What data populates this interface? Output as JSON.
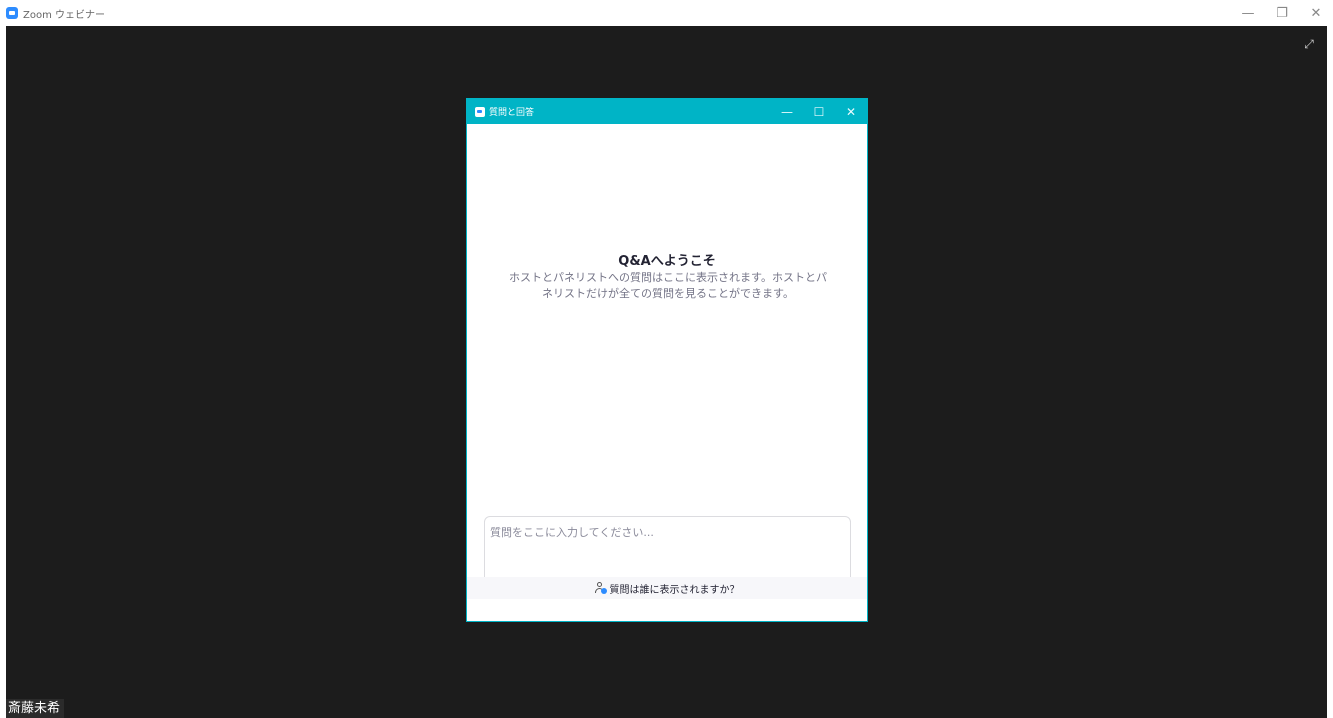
{
  "main_window": {
    "title": "Zoom ウェビナー",
    "controls": {
      "minimize": "—",
      "restore": "❐",
      "close": "✕"
    }
  },
  "video": {
    "participant_name": "斎藤未希",
    "expand_icon": "expand-icon"
  },
  "qa_dialog": {
    "title": "質問と回答",
    "controls": {
      "minimize": "—",
      "maximize": "☐",
      "close": "✕"
    },
    "welcome_title": "Q&Aへようこそ",
    "welcome_description": "ホストとパネリストへの質問はここに表示されます。ホストとパネリストだけが全ての質問を見ることができます。",
    "question_placeholder": "質問をここに入力してください...",
    "footer_link": "質問は誰に表示されますか？"
  },
  "colors": {
    "accent": "#00b4c6",
    "zoom_blue": "#2d8cff",
    "video_bg": "#1c1c1c"
  }
}
